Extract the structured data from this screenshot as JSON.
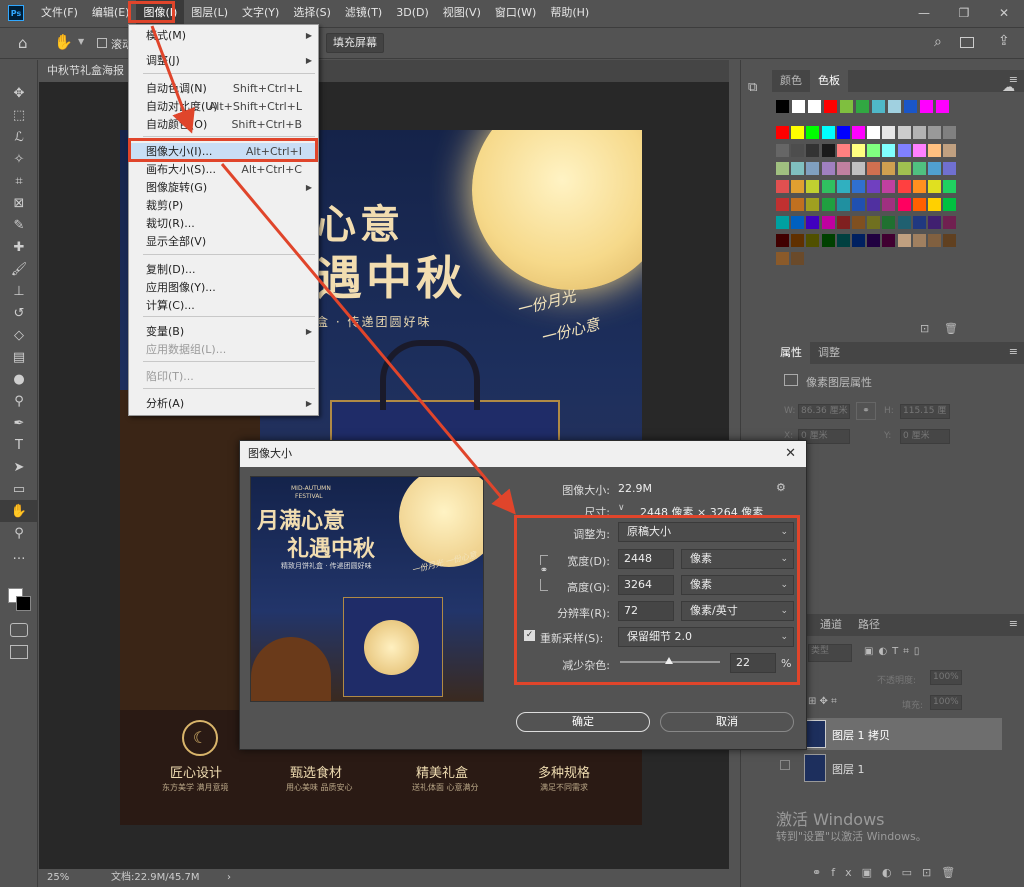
{
  "menubar": {
    "logo": "Ps",
    "items": [
      "文件(F)",
      "编辑(E)",
      "图像(I)",
      "图层(L)",
      "文字(Y)",
      "选择(S)",
      "滤镜(T)",
      "3D(D)",
      "视图(V)",
      "窗口(W)",
      "帮助(H)"
    ],
    "window_controls": [
      "—",
      "❐",
      "✕"
    ]
  },
  "optbar": {
    "checkbox_label": "滚动",
    "fill_screen": "填充屏幕"
  },
  "document": {
    "tab_title": "中秋节礼盒海报全",
    "zoom": "25%",
    "doc_size": "文档:22.9M/45.7M"
  },
  "image_menu": {
    "items": [
      {
        "label": "模式(M)",
        "shortcut": "",
        "arrow": true,
        "disabled": false
      },
      {
        "label": "调整(J)",
        "shortcut": "",
        "arrow": true,
        "disabled": false
      },
      {
        "label": "自动色调(N)",
        "shortcut": "Shift+Ctrl+L",
        "arrow": false,
        "disabled": false
      },
      {
        "label": "自动对比度(U)",
        "shortcut": "Alt+Shift+Ctrl+L",
        "arrow": false,
        "disabled": false
      },
      {
        "label": "自动颜色(O)",
        "shortcut": "Shift+Ctrl+B",
        "arrow": false,
        "disabled": false
      },
      {
        "label": "图像大小(I)...",
        "shortcut": "Alt+Ctrl+I",
        "arrow": false,
        "disabled": false
      },
      {
        "label": "画布大小(S)...",
        "shortcut": "Alt+Ctrl+C",
        "arrow": false,
        "disabled": false
      },
      {
        "label": "图像旋转(G)",
        "shortcut": "",
        "arrow": true,
        "disabled": false
      },
      {
        "label": "裁剪(P)",
        "shortcut": "",
        "arrow": false,
        "disabled": false
      },
      {
        "label": "裁切(R)...",
        "shortcut": "",
        "arrow": false,
        "disabled": false
      },
      {
        "label": "显示全部(V)",
        "shortcut": "",
        "arrow": false,
        "disabled": false
      },
      {
        "label": "复制(D)...",
        "shortcut": "",
        "arrow": false,
        "disabled": false
      },
      {
        "label": "应用图像(Y)...",
        "shortcut": "",
        "arrow": false,
        "disabled": false
      },
      {
        "label": "计算(C)...",
        "shortcut": "",
        "arrow": false,
        "disabled": false
      },
      {
        "label": "变量(B)",
        "shortcut": "",
        "arrow": true,
        "disabled": false
      },
      {
        "label": "应用数据组(L)...",
        "shortcut": "",
        "arrow": false,
        "disabled": true
      },
      {
        "label": "陷印(T)...",
        "shortcut": "",
        "arrow": false,
        "disabled": true
      },
      {
        "label": "分析(A)",
        "shortcut": "",
        "arrow": true,
        "disabled": false
      }
    ]
  },
  "color_panel": {
    "tabs": [
      "颜色",
      "色板"
    ],
    "top_row": [
      "#000000",
      "#ffffff",
      "#ffffff",
      "#ff0000",
      "#7fbf3f",
      "#31a842",
      "#4fb8c8",
      "#a0d0e0",
      "#1a56c8",
      "#ff00ff",
      "#ff00ff"
    ],
    "rows": [
      [
        "#ff0000",
        "#ffff00",
        "#00ff00",
        "#00ffff",
        "#0000ff",
        "#ff00ff",
        "#ffffff",
        "#e6e6e6",
        "#cccccc",
        "#b3b3b3",
        "#999999",
        "#808080"
      ],
      [
        "#666666",
        "#4d4d4d",
        "#333333",
        "#1a1a1a",
        "#ff8080",
        "#ffff80",
        "#80ff80",
        "#80ffff",
        "#8080ff",
        "#ff80ff",
        "#ffc080",
        "#c0a080"
      ],
      [
        "#a0c080",
        "#80c0c0",
        "#80a0c0",
        "#a080c0",
        "#c080a0",
        "#c0c0c0",
        "#d07050",
        "#d0a050",
        "#a0c050",
        "#50c080",
        "#50a0d0",
        "#7070d0"
      ],
      [
        "#e05050",
        "#e0a030",
        "#c0d030",
        "#30c060",
        "#30b0c0",
        "#3070d0",
        "#7040c0",
        "#c040a0",
        "#ff4040",
        "#ff9020",
        "#e0e020",
        "#20d060"
      ],
      [
        "#c03030",
        "#c07020",
        "#a0a020",
        "#20a040",
        "#2090a0",
        "#2050b0",
        "#5030a0",
        "#a03080",
        "#ff0060",
        "#ff6000",
        "#ffd000",
        "#00c040"
      ],
      [
        "#00a0a0",
        "#0060c0",
        "#4000c0",
        "#c000a0",
        "#802020",
        "#805020",
        "#707020",
        "#207030",
        "#206070",
        "#203880",
        "#402070",
        "#702050"
      ],
      [
        "#400000",
        "#603000",
        "#505000",
        "#004000",
        "#004040",
        "#002060",
        "#200040",
        "#400030",
        "#c0a080",
        "#a08060",
        "#806040",
        "#604020"
      ],
      [
        "#8a5a2a",
        "#6a4a2a"
      ]
    ]
  },
  "properties_panel": {
    "tabs": [
      "属性",
      "调整"
    ],
    "title": "像素图层属性",
    "w_label": "W:",
    "w_value": "86.36 厘米",
    "h_label": "H:",
    "h_value": "115.15 厘",
    "x_label": "X:",
    "x_value": "0 厘米",
    "y_label": "Y:",
    "y_value": "0 厘米"
  },
  "layers_panel": {
    "tabs": [
      "通道",
      "路径"
    ],
    "kind_label": "类型",
    "opacity_label": "不透明度:",
    "opacity_value": "100%",
    "fill_label": "填充:",
    "fill_value": "100%",
    "layers": [
      {
        "name": "图层 1 拷贝",
        "selected": true
      },
      {
        "name": "图层 1",
        "selected": false
      }
    ]
  },
  "watermark": {
    "line1": "激活 Windows",
    "line2": "转到\"设置\"以激活 Windows。"
  },
  "poster": {
    "title_line1": "心意",
    "title_line2": "遇中秋",
    "subtitle": "盒 · 传递团圆好味",
    "calligraphy_1": "一份月光",
    "calligraphy_2": "一份心意",
    "features": [
      {
        "title": "匠心设计",
        "desc": "东方美学  满月意境"
      },
      {
        "title": "甄选食材",
        "desc": "用心美味  品质安心"
      },
      {
        "title": "精美礼盒",
        "desc": "送礼体面  心意满分"
      },
      {
        "title": "多种规格",
        "desc": "满足不同需求"
      }
    ]
  },
  "dialog": {
    "title": "图像大小",
    "close": "✕",
    "image_size_label": "图像大小:",
    "image_size_value": "22.9M",
    "dims_label": "尺寸:",
    "dims_value": "2448 像素 × 3264 像素",
    "fit_label": "调整为:",
    "fit_value": "原稿大小",
    "width_label": "宽度(D):",
    "width_value": "2448",
    "width_unit": "像素",
    "height_label": "高度(G):",
    "height_value": "3264",
    "height_unit": "像素",
    "res_label": "分辨率(R):",
    "res_value": "72",
    "res_unit": "像素/英寸",
    "resample_label": "重新采样(S):",
    "resample_value": "保留细节 2.0",
    "noise_label": "减少杂色:",
    "noise_value": "22",
    "noise_unit": "%",
    "ok": "确定",
    "cancel": "取消",
    "preview": {
      "en_1": "MID-AUTUMN",
      "en_2": "FESTIVAL",
      "title_1": "月满心意",
      "title_2": "礼遇中秋",
      "subtitle": "精致月饼礼盒 · 传递团圆好味",
      "calligraphy": "一份月光 一份心意"
    }
  }
}
